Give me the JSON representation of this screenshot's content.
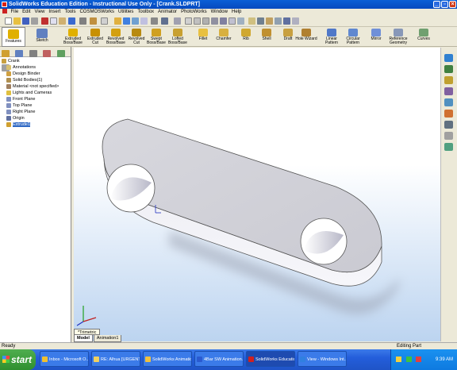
{
  "window": {
    "title": "SolidWorks Education Edition - Instructional Use Only - [Crank.SLDPRT]"
  },
  "menus": [
    "File",
    "Edit",
    "View",
    "Insert",
    "Tools",
    "COSMOSWorks",
    "Utilities",
    "Toolbox",
    "Animator",
    "PhotoWorks",
    "Window",
    "Help"
  ],
  "command_manager": {
    "tabs": [
      {
        "label": "Features"
      },
      {
        "label": "Sketch"
      }
    ],
    "items": [
      {
        "label1": "Extruded",
        "label2": "Boss/Base",
        "icon": "extruded-boss-icon",
        "color": "#e0b000"
      },
      {
        "label1": "Extruded",
        "label2": "Cut",
        "icon": "extruded-cut-icon",
        "color": "#c89000"
      },
      {
        "label1": "Revolved",
        "label2": "Boss/Base",
        "icon": "revolved-boss-icon",
        "color": "#d4a010"
      },
      {
        "label1": "Revolved",
        "label2": "Cut",
        "icon": "revolved-cut-icon",
        "color": "#b88a10"
      },
      {
        "label1": "Swept",
        "label2": "Boss/Base",
        "icon": "swept-boss-icon",
        "color": "#d0a020"
      },
      {
        "label1": "Lofted",
        "label2": "Boss/Base",
        "icon": "lofted-boss-icon",
        "color": "#c8a030"
      },
      {
        "label1": "Fillet",
        "label2": "",
        "icon": "fillet-icon",
        "color": "#e8c040"
      },
      {
        "label1": "Chamfer",
        "label2": "",
        "icon": "chamfer-icon",
        "color": "#d8b040"
      },
      {
        "label1": "Rib",
        "label2": "",
        "icon": "rib-icon",
        "color": "#d0a830"
      },
      {
        "label1": "Shell",
        "label2": "",
        "icon": "shell-icon",
        "color": "#c09030"
      },
      {
        "label1": "Draft",
        "label2": "",
        "icon": "draft-icon",
        "color": "#c8a040"
      },
      {
        "label1": "Hole Wizard",
        "label2": "",
        "icon": "hole-wizard-icon",
        "color": "#b08030"
      },
      {
        "label1": "Linear",
        "label2": "Pattern",
        "icon": "linear-pattern-icon",
        "color": "#5078c8"
      },
      {
        "label1": "Circular",
        "label2": "Pattern",
        "icon": "circular-pattern-icon",
        "color": "#6088d0"
      },
      {
        "label1": "Mirror",
        "label2": "",
        "icon": "mirror-icon",
        "color": "#7090d8"
      },
      {
        "label1": "Reference",
        "label2": "Geometry",
        "icon": "reference-geometry-icon",
        "color": "#8898b8"
      },
      {
        "label1": "Curves",
        "label2": "",
        "icon": "curves-icon",
        "color": "#70a070"
      }
    ]
  },
  "feature_tree": [
    {
      "label": "Crank",
      "icon": "part-icon",
      "color": "#c8a040",
      "indent": 0
    },
    {
      "label": "Annotations",
      "icon": "annotations-icon",
      "color": "#d8c070",
      "indent": 1
    },
    {
      "label": "Design Binder",
      "icon": "design-binder-icon",
      "color": "#d0a040",
      "indent": 1
    },
    {
      "label": "Solid Bodies(1)",
      "icon": "solid-bodies-icon",
      "color": "#b09050",
      "indent": 1
    },
    {
      "label": "Material <not specified>",
      "icon": "material-icon",
      "color": "#a08060",
      "indent": 1
    },
    {
      "label": "Lights and Cameras",
      "icon": "lights-icon",
      "color": "#e0c040",
      "indent": 1
    },
    {
      "label": "Front Plane",
      "icon": "plane-icon",
      "color": "#8090c0",
      "indent": 1
    },
    {
      "label": "Top Plane",
      "icon": "plane-icon",
      "color": "#8090c0",
      "indent": 1
    },
    {
      "label": "Right Plane",
      "icon": "plane-icon",
      "color": "#8090c0",
      "indent": 1
    },
    {
      "label": "Origin",
      "icon": "origin-icon",
      "color": "#6070a0",
      "indent": 1
    },
    {
      "label": "Extrude1",
      "icon": "extrude-icon",
      "color": "#d0a030",
      "indent": 1,
      "selected": true
    }
  ],
  "view": {
    "orientation": "*Trimetric",
    "tabs": [
      {
        "label": "Model",
        "active": true
      },
      {
        "label": "Animation1",
        "active": false
      }
    ]
  },
  "status": {
    "left": "Ready",
    "right": "Editing Part"
  },
  "taskbar": {
    "start": "start",
    "tasks": [
      {
        "label": "Inbox - Microsoft O...",
        "color": "#f0c030"
      },
      {
        "label": "RE: Alhua [URGENT...",
        "color": "#f0d060"
      },
      {
        "label": "SolidWorks Animation",
        "color": "#f0c040"
      },
      {
        "label": "4Bar SW Animation...",
        "color": "#2a5ad0"
      },
      {
        "label": "SolidWorks Educatio...",
        "color": "#d02020",
        "active": true
      },
      {
        "label": "View - Windows Int...",
        "color": "#3080e0"
      }
    ],
    "clock": "9:39 AM"
  },
  "colors": {
    "title": "#0a5fd6",
    "selection": "#316ac5",
    "taskbar": "#245edb"
  }
}
